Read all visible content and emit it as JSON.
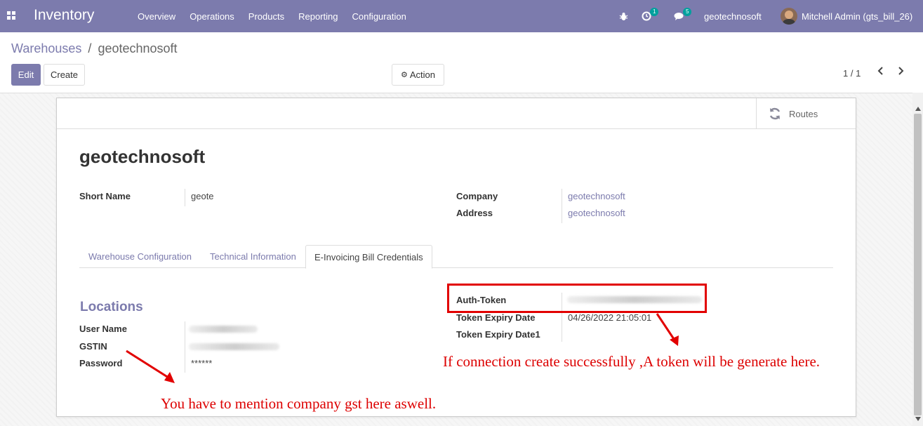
{
  "navbar": {
    "brand": "Inventory",
    "menu": [
      "Overview",
      "Operations",
      "Products",
      "Reporting",
      "Configuration"
    ],
    "activity_count": "1",
    "message_count": "5",
    "company": "geotechnosoft",
    "user": "Mitchell Admin (gts_bill_26)"
  },
  "breadcrumb": {
    "parent": "Warehouses",
    "separator": "/",
    "current": "geotechnosoft"
  },
  "buttons": {
    "edit": "Edit",
    "create": "Create",
    "action": "Action"
  },
  "pager": {
    "value": "1 / 1"
  },
  "smart_button": {
    "routes": "Routes"
  },
  "record": {
    "name": "geotechnosoft",
    "short_name_label": "Short Name",
    "short_name": "geote",
    "company_label": "Company",
    "company": "geotechnosoft",
    "address_label": "Address",
    "address": "geotechnosoft"
  },
  "tabs": [
    "Warehouse Configuration",
    "Technical Information",
    "E-Invoicing Bill Credentials"
  ],
  "credentials": {
    "section_title": "Locations",
    "user_name_label": "User Name",
    "gstin_label": "GSTIN",
    "password_label": "Password",
    "password": "******",
    "auth_token_label": "Auth-Token",
    "token_expiry_label": "Token Expiry Date",
    "token_expiry": "04/26/2022 21:05:01",
    "token_expiry1_label": "Token Expiry Date1"
  },
  "annotations": {
    "token_note": "If connection create successfully ,A token will  be generate here.",
    "gst_note": "You have to mention company gst here aswell."
  },
  "colors": {
    "navbar": "#7c7bad",
    "link": "#7c7bad",
    "annotation": "#dd0000",
    "badge": "#00a09d"
  }
}
